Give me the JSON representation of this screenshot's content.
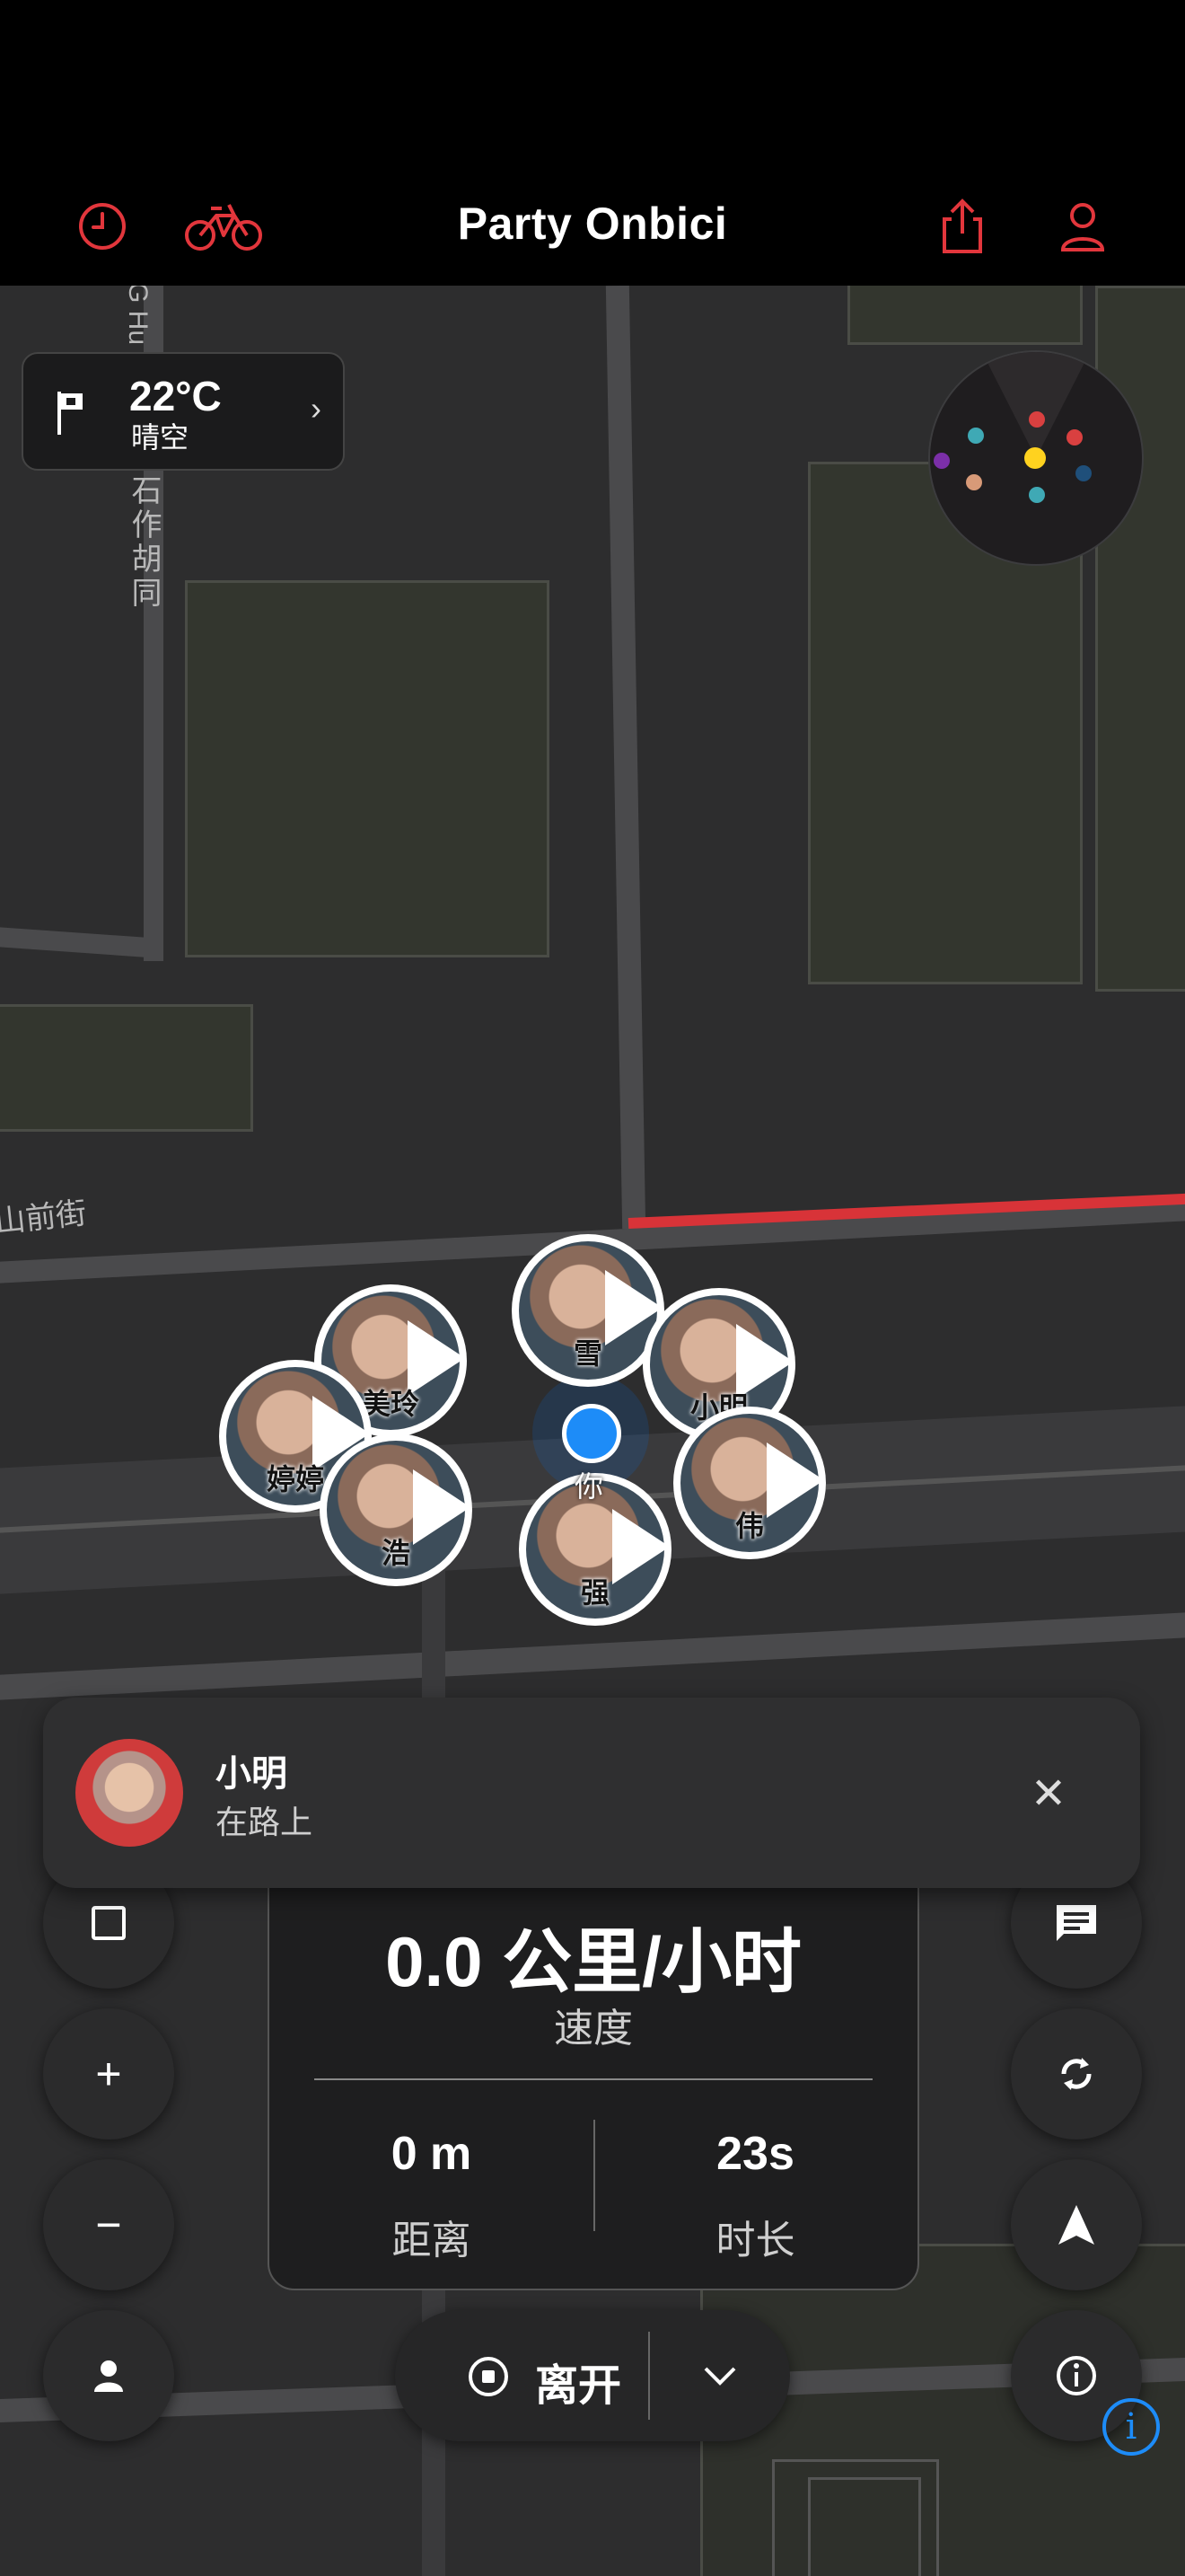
{
  "app": {
    "title": "Party Onbici",
    "accent_color": "#e2363c",
    "icons": [
      "history-icon",
      "bike-icon",
      "share-icon",
      "profile-icon"
    ]
  },
  "map": {
    "streets": [
      "山前街",
      "石作胡同",
      "G Hu"
    ],
    "route_color": "#d83338"
  },
  "weather": {
    "temp": "22°C",
    "condition": "晴空",
    "icon": "flag-icon"
  },
  "radar": {
    "dots": [
      "#d94040",
      "#3fa9b5",
      "#ffd21f",
      "#d94040",
      "#7b2fa8",
      "#d89a78",
      "#3fa9b5",
      "#1f4f7a"
    ]
  },
  "riders": [
    {
      "name": "雪"
    },
    {
      "name": "美玲"
    },
    {
      "name": "小明"
    },
    {
      "name": "婷婷"
    },
    {
      "name": "伟"
    },
    {
      "name": "浩"
    },
    {
      "name": "强"
    }
  ],
  "you_label": "你",
  "notification": {
    "name": "小明",
    "status": "在路上"
  },
  "stats": {
    "speed": "0.0 公里/小时",
    "speed_label": "速度",
    "distance": "0 m",
    "distance_label": "距离",
    "duration": "23s",
    "duration_label": "时长"
  },
  "controls": {
    "leave_label": "离开"
  }
}
